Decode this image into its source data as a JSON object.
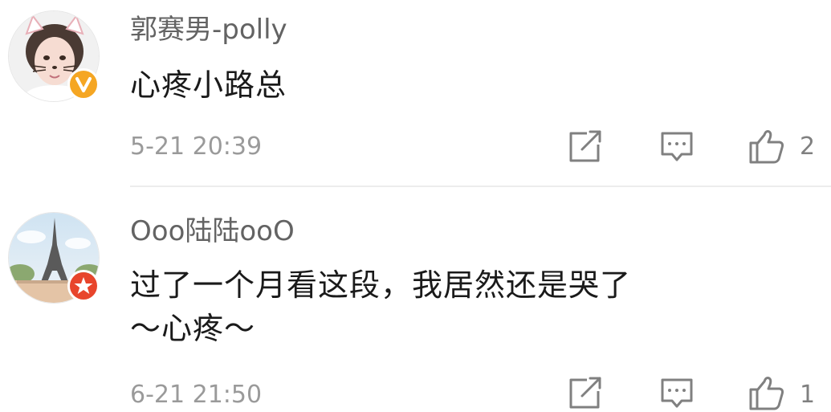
{
  "comments": [
    {
      "username": "郭赛男-polly",
      "text": "心疼小路总",
      "time": "5-21 20:39",
      "likes": "2",
      "badge": "verified-v-badge",
      "badge_color": "#f5a623"
    },
    {
      "username": "Ooo陆陆ooO",
      "text": "过了一个月看这段，我居然还是哭了～心疼～",
      "time": "6-21 21:50",
      "likes": "1",
      "badge": "member-star-badge",
      "badge_color": "#e8452c"
    }
  ],
  "icons": {
    "repost": "repost-icon",
    "reply": "comment-icon",
    "like": "thumbs-up-icon"
  },
  "colors": {
    "username": "#636363",
    "text": "#1a1a1a",
    "meta": "#9a9a9a",
    "icon": "#808080",
    "divider": "#ececec"
  }
}
